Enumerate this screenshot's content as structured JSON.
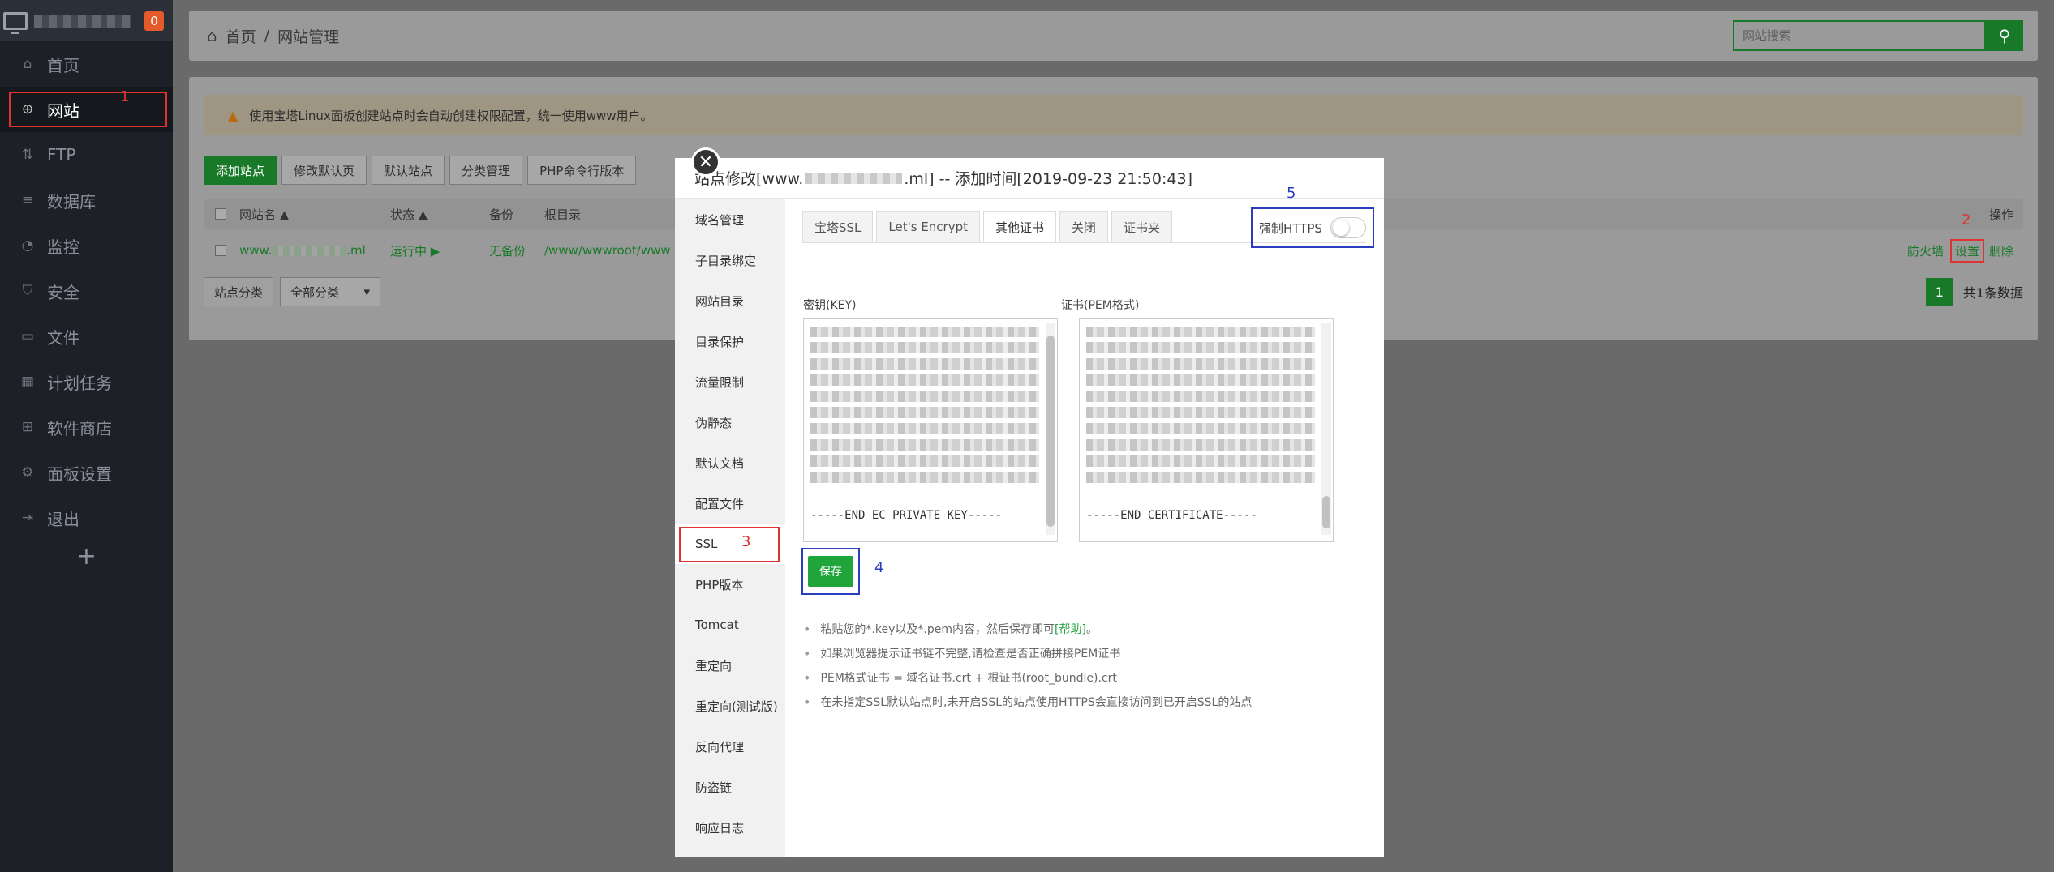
{
  "sidebar": {
    "badge": "0",
    "items": [
      {
        "label": "首页",
        "icon": "home-icon",
        "glyph": "⌂"
      },
      {
        "label": "网站",
        "icon": "globe-icon",
        "glyph": "⊕"
      },
      {
        "label": "FTP",
        "icon": "ftp-icon",
        "glyph": "⇅"
      },
      {
        "label": "数据库",
        "icon": "database-icon",
        "glyph": "≡"
      },
      {
        "label": "监控",
        "icon": "monitor-icon",
        "glyph": "◔"
      },
      {
        "label": "安全",
        "icon": "shield-icon",
        "glyph": "⛉"
      },
      {
        "label": "文件",
        "icon": "folder-icon",
        "glyph": "▭"
      },
      {
        "label": "计划任务",
        "icon": "calendar-icon",
        "glyph": "▦"
      },
      {
        "label": "软件商店",
        "icon": "apps-icon",
        "glyph": "⊞"
      },
      {
        "label": "面板设置",
        "icon": "gear-icon",
        "glyph": "⚙"
      },
      {
        "label": "退出",
        "icon": "logout-icon",
        "glyph": "⇥"
      }
    ],
    "plus": "+",
    "annotation": "1"
  },
  "header": {
    "breadcrumb_home": "首页",
    "breadcrumb_sep": "/",
    "breadcrumb_current": "网站管理",
    "search_placeholder": "网站搜索"
  },
  "site_list": {
    "notice": "使用宝塔Linux面板创建站点时会自动创建权限配置，统一使用www用户。",
    "toolbar": [
      "添加站点",
      "修改默认页",
      "默认站点",
      "分类管理",
      "PHP命令行版本"
    ],
    "columns": {
      "name": "网站名",
      "status": "状态",
      "backup": "备份",
      "root": "根目录",
      "ops": "操作"
    },
    "row": {
      "name_prefix": "www.",
      "name_suffix": ".ml",
      "status": "运行中 ▶",
      "backup": "无备份",
      "root": "/www/wwwroot/www",
      "firewall": "防火墙",
      "settings": "设置",
      "delete": "删除"
    },
    "filter_label": "站点分类",
    "filter_value": "全部分类",
    "page": "1",
    "total": "共1条数据",
    "annotation": "2"
  },
  "modal": {
    "title_prefix": "站点修改[www.",
    "title_suffix": ".ml] -- 添加时间[2019-09-23 21:50:43]",
    "close": "✕",
    "menu": [
      "域名管理",
      "子目录绑定",
      "网站目录",
      "目录保护",
      "流量限制",
      "伪静态",
      "默认文档",
      "配置文件",
      "SSL",
      "PHP版本",
      "Tomcat",
      "重定向",
      "重定向(测试版)",
      "反向代理",
      "防盗链",
      "响应日志"
    ],
    "menu_active_index": 8,
    "menu_annotation": "3",
    "tabs": [
      "宝塔SSL",
      "Let's Encrypt",
      "其他证书",
      "关闭",
      "证书夹"
    ],
    "tab_active_index": 2,
    "force_https": "强制HTTPS",
    "https_annotation": "5",
    "key_label": "密钥(KEY)",
    "cert_label": "证书(PEM格式)",
    "key_end": "-----END EC PRIVATE KEY-----",
    "cert_end": "-----END CERTIFICATE-----",
    "save": "保存",
    "save_annotation": "4",
    "tips": {
      "t1_prefix": "粘贴您的*.key以及*.pem内容，然后保存即可",
      "t1_link": "[帮助]",
      "t1_suffix": "。",
      "t2": "如果浏览器提示证书链不完整,请检查是否正确拼接PEM证书",
      "t3": "PEM格式证书 = 域名证书.crt + 根证书(root_bundle).crt",
      "t4": "在未指定SSL默认站点时,未开启SSL的站点使用HTTPS会直接访问到已开启SSL的站点"
    }
  }
}
